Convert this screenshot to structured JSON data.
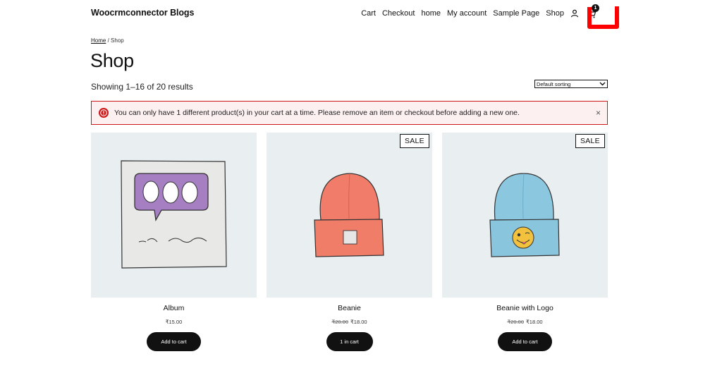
{
  "header": {
    "site_title": "Woocrmconnector Blogs",
    "nav": [
      "Cart",
      "Checkout",
      "home",
      "My account",
      "Sample Page",
      "Shop"
    ],
    "cart_count": "1"
  },
  "breadcrumb": {
    "home": "Home",
    "separator": " / ",
    "current": "Shop"
  },
  "page_title": "Shop",
  "result_count": "Showing 1–16 of 20 results",
  "sorting": {
    "selected": "Default sorting"
  },
  "notice": {
    "message": "You can only have 1 different product(s) in your cart at a time. Please remove an item or checkout before adding a new one.",
    "close": "×"
  },
  "products": [
    {
      "name": "Album",
      "price": "₹15.00",
      "regular_price": "",
      "sale": "",
      "button": "Add to cart"
    },
    {
      "name": "Beanie",
      "price": "₹18.00",
      "regular_price": "₹20.00",
      "sale": "SALE",
      "button": "1 in cart"
    },
    {
      "name": "Beanie with Logo",
      "price": "₹18.00",
      "regular_price": "₹20.00",
      "sale": "SALE",
      "button": "Add to cart"
    }
  ],
  "colors": {
    "notice_border": "#cc1818",
    "notice_bg": "#fcf0f1",
    "thumb_bg": "#e9eef1",
    "button_bg": "#111111",
    "annotation": "#ff0000"
  },
  "icons": [
    "account-icon",
    "cart-icon",
    "error-icon",
    "close-icon",
    "chevron-down-icon"
  ]
}
